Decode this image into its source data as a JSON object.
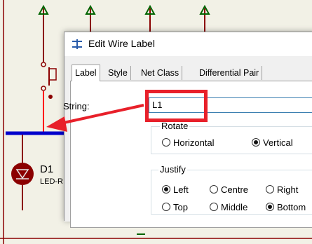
{
  "schematic": {
    "component_ref": "D1",
    "component_value": "LED-R",
    "colors": {
      "background": "#f2f1e6",
      "wire": "#8b0000",
      "terminal": "#006400",
      "bus": "#0000cc",
      "selected_wire": "#ff0000"
    }
  },
  "dialog": {
    "title": "Edit Wire Label",
    "tabs": [
      {
        "label": "Label",
        "active": true
      },
      {
        "label": "Style",
        "active": false
      },
      {
        "label": "Net Class",
        "active": false
      },
      {
        "label": "Differential Pair",
        "active": false
      }
    ],
    "string_label": "String:",
    "string_value": "L1",
    "rotate": {
      "title": "Rotate",
      "options": [
        {
          "label": "Horizontal",
          "checked": false
        },
        {
          "label": "Vertical",
          "checked": true
        }
      ]
    },
    "justify": {
      "title": "Justify",
      "options": [
        {
          "label": "Left",
          "checked": true
        },
        {
          "label": "Centre",
          "checked": false
        },
        {
          "label": "Right",
          "checked": false
        },
        {
          "label": "Top",
          "checked": false
        },
        {
          "label": "Middle",
          "checked": false
        },
        {
          "label": "Bottom",
          "checked": true
        }
      ]
    }
  },
  "annotation": {
    "color": "#e8202a"
  }
}
